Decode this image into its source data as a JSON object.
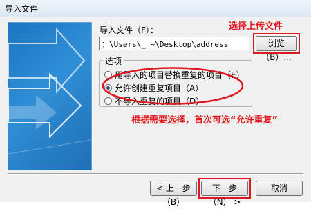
{
  "window": {
    "title": "导入文件"
  },
  "import_file": {
    "label": "导入文件（F）：",
    "path_value": "；\\Users\\_           ~\\Desktop\\address",
    "browse_label": "浏览（B）..."
  },
  "options": {
    "label": "选项",
    "items": [
      {
        "label": "用导入的项目替换重复的项目（E）",
        "checked": false
      },
      {
        "label": "允许创建重复项目（A）",
        "checked": true
      },
      {
        "label": "不导入重复的项目（D）",
        "checked": false
      }
    ]
  },
  "annotations": {
    "upload": "选择上传文件",
    "recommend": "根据需要选择，首次可选“允许重复”",
    "color": "#e0181e"
  },
  "footer": {
    "back_label": "< 上一步（B）",
    "next_label": "下一步（N） >",
    "cancel_label": "取消"
  }
}
